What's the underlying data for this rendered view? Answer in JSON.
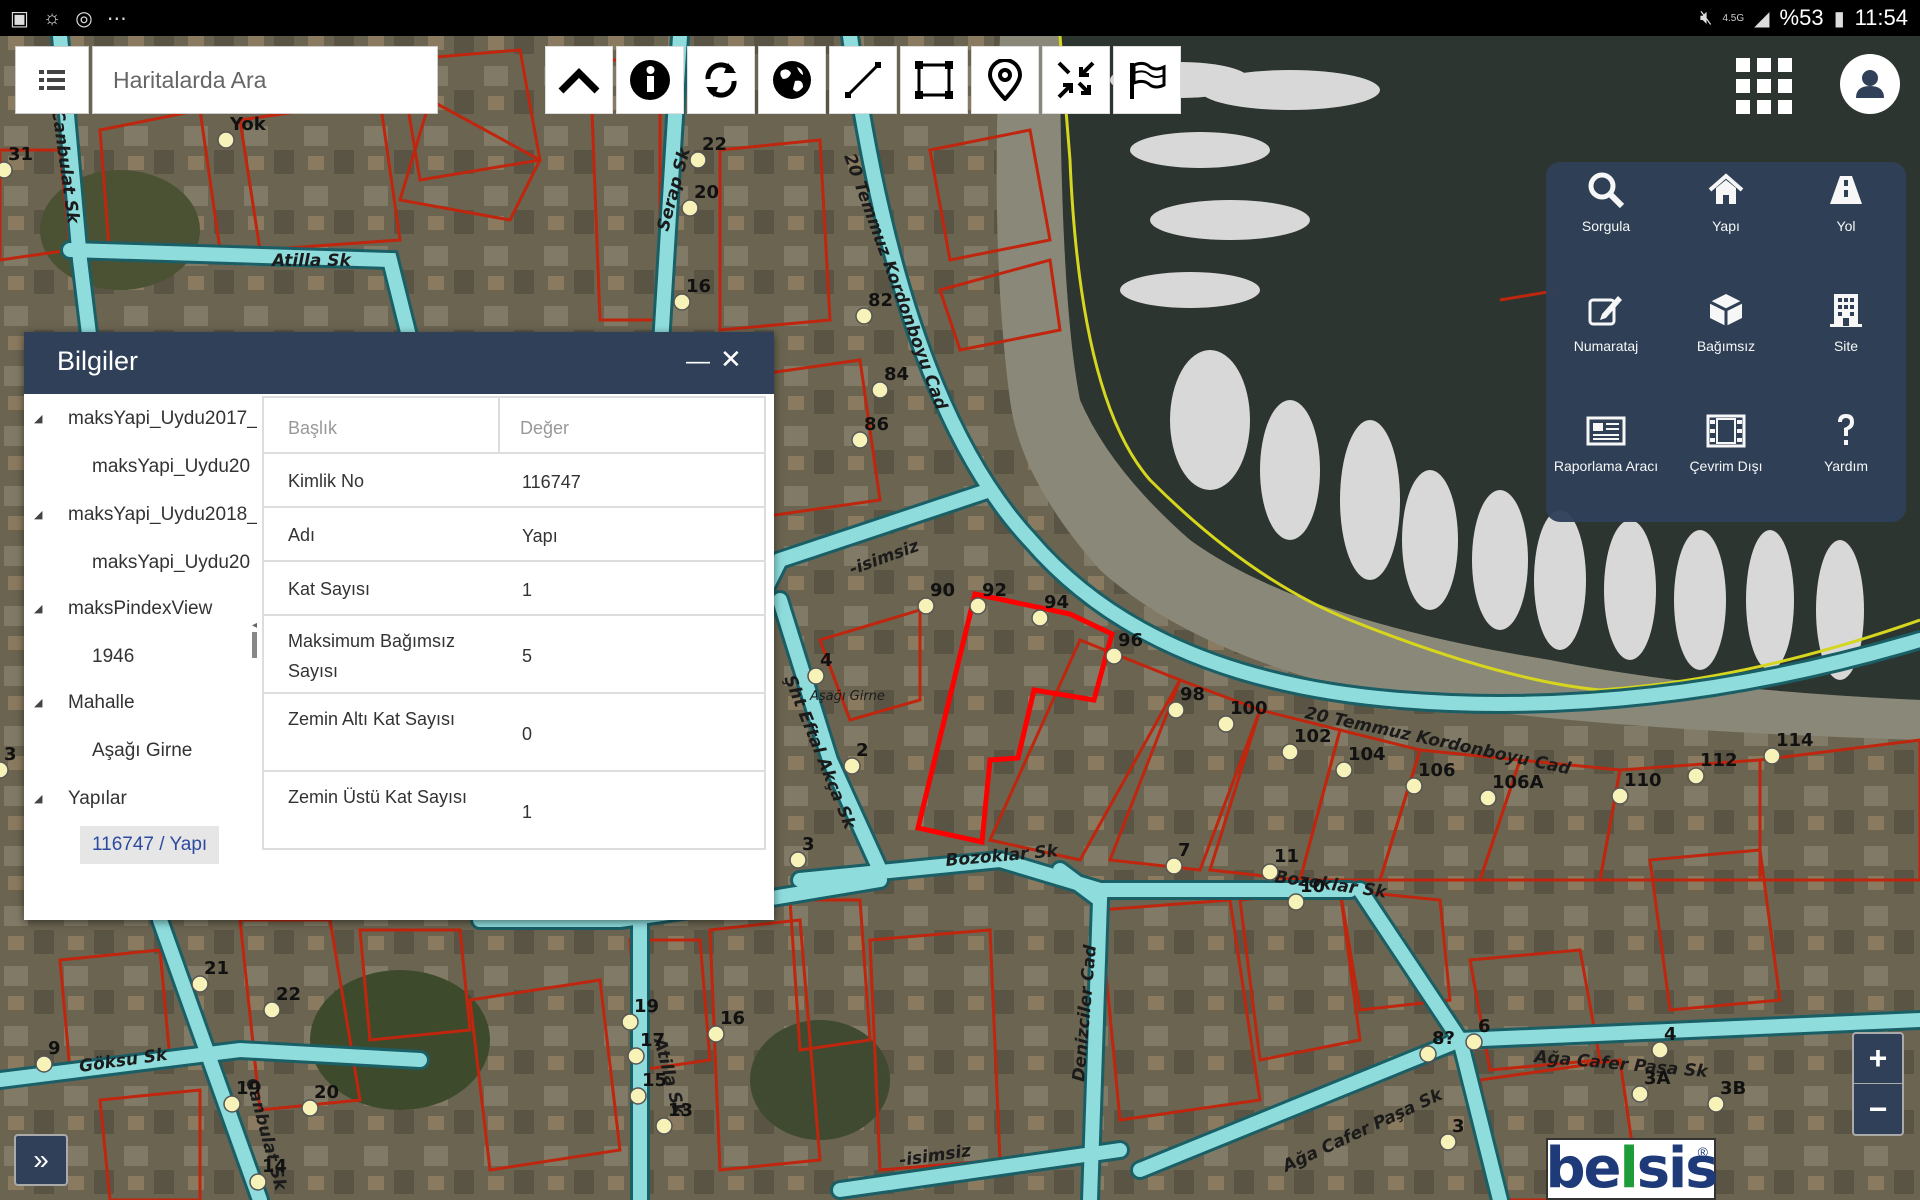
{
  "status_bar": {
    "battery": "%53",
    "time": "11:54",
    "network": "4.5G"
  },
  "search": {
    "placeholder": "Haritalarda Ara"
  },
  "toolbar": {
    "tools": [
      "chevron-up-icon",
      "info-icon",
      "refresh-icon",
      "globe-icon",
      "measure-line-icon",
      "select-area-icon",
      "location-pin-icon",
      "shrink-icon",
      "flag-icon"
    ]
  },
  "quick_menu": {
    "items": [
      {
        "label": "Sorgula",
        "icon": "search-icon"
      },
      {
        "label": "Yapı",
        "icon": "home-icon"
      },
      {
        "label": "Yol",
        "icon": "road-icon"
      },
      {
        "label": "Numarataj",
        "icon": "edit-icon"
      },
      {
        "label": "Bağımsız",
        "icon": "cube-icon"
      },
      {
        "label": "Site",
        "icon": "building-icon"
      },
      {
        "label": "Raporlama Aracı",
        "icon": "newspaper-icon"
      },
      {
        "label": "Çevrim Dışı",
        "icon": "film-icon"
      },
      {
        "label": "Yardım",
        "icon": "question-icon"
      }
    ]
  },
  "info_panel": {
    "title": "Bilgiler",
    "tree": [
      {
        "label": "maksYapi_Uydu2017_",
        "level": 0
      },
      {
        "label": "maksYapi_Uydu20",
        "level": 1
      },
      {
        "label": "maksYapi_Uydu2018_",
        "level": 0
      },
      {
        "label": "maksYapi_Uydu20",
        "level": 1
      },
      {
        "label": "maksPindexView",
        "level": 0
      },
      {
        "label": "1946",
        "level": 1
      },
      {
        "label": "Mahalle",
        "level": 0
      },
      {
        "label": "Aşağı Girne",
        "level": 1
      },
      {
        "label": "Yapılar",
        "level": 0
      },
      {
        "label": "116747 / Yapı",
        "level": 1,
        "selected": true
      }
    ],
    "table_header": {
      "key": "Başlık",
      "value": "Değer"
    },
    "rows": [
      {
        "key": "Kimlik No",
        "value": "116747"
      },
      {
        "key": "Adı",
        "value": "Yapı"
      },
      {
        "key": "Kat Sayısı",
        "value": "1"
      },
      {
        "key": "Maksimum Bağımsız Sayısı",
        "value": "5"
      },
      {
        "key": "Zemin Altı Kat Sayısı",
        "value": "0"
      },
      {
        "key": "Zemin Üstü Kat Sayısı",
        "value": "1"
      }
    ]
  },
  "map": {
    "streets": [
      "Atilla Sk",
      "Serap Sk",
      "20 Temmuz Kordonboyu Cad",
      "-isimsiz",
      "Şht Eftal Akça Sk",
      "Bozoklar Sk",
      "20 Temmuz Kordonboyu Cad",
      "Bozoklar Sk",
      "Denizciler Cad",
      "Ağa Cafer Paşa Sk",
      "Ağa Cafer Paşa Sk",
      "-isimsiz",
      "Göksu Sk",
      "Atilla Sk",
      "Canbulat Sk",
      "Canbulat Sk",
      "Aşağı Girne"
    ],
    "numbers": [
      "Yok",
      "31",
      "22",
      "20",
      "16",
      "82",
      "84",
      "86",
      "90",
      "92",
      "94",
      "96",
      "98",
      "100",
      "102",
      "104",
      "106",
      "106A",
      "110",
      "112",
      "114",
      "4",
      "2",
      "3",
      "7",
      "11",
      "10",
      "21",
      "22",
      "19",
      "17",
      "15",
      "13",
      "16",
      "9",
      "19",
      "20",
      "14",
      "8?",
      "6",
      "4",
      "3A",
      "3B",
      "3",
      "3"
    ],
    "colors": {
      "road": "#8fdcdc",
      "parcel": "#c0250e",
      "selected": "#ff0000",
      "coast": "#d6d61e"
    }
  },
  "zoom": {
    "in": "+",
    "out": "−"
  },
  "expand": "»",
  "logo": {
    "main": "be",
    "accent": "l",
    "rest": "sis",
    "reg": "®"
  }
}
